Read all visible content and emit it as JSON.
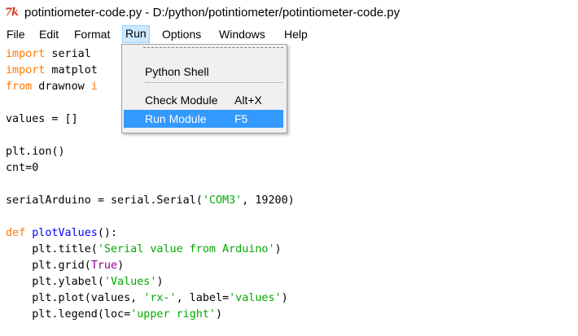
{
  "window": {
    "title": "potintiometer-code.py - D:/python/potintiometer/potintiometer-code.py",
    "icon": "idle-feather-icon"
  },
  "menubar": {
    "items": [
      "File",
      "Edit",
      "Format",
      "Run",
      "Options",
      "Windows",
      "Help"
    ],
    "active": "Run"
  },
  "run_menu": {
    "items": [
      {
        "label": "Python Shell",
        "shortcut": ""
      },
      {
        "label": "Check Module",
        "shortcut": "Alt+X"
      },
      {
        "label": "Run Module",
        "shortcut": "F5"
      }
    ],
    "highlighted": "Run Module"
  },
  "editor": {
    "colors": {
      "keyword": "#ff7700",
      "string": "#00aa00",
      "definition": "#0000ff",
      "builtin": "#900090",
      "menu_highlight": "#3399ff"
    },
    "lines": [
      "import serial",
      "import matplot",
      "from drawnow i",
      "",
      "values = []",
      "",
      "plt.ion()",
      "cnt=0",
      "",
      "serialArduino = serial.Serial('COM3', 19200)",
      "",
      "def plotValues():",
      "    plt.title('Serial value from Arduino')",
      "    plt.grid(True)",
      "    plt.ylabel('Values')",
      "    plt.plot(values, 'rx-', label='values')",
      "    plt.legend(loc='upper right')"
    ]
  }
}
